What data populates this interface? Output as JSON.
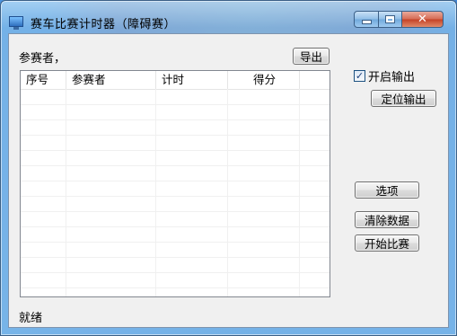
{
  "window": {
    "title": "赛车比赛计时器（障碍赛）"
  },
  "left_panel": {
    "participants_label": "参赛者，",
    "export_button": "导出"
  },
  "table": {
    "columns": [
      "序号",
      "参赛者",
      "计时",
      "得分"
    ],
    "rows": []
  },
  "right_panel": {
    "output_checkbox_label": "开启输出",
    "output_checked": true,
    "locate_output_button": "定位输出",
    "options_button": "选项",
    "clear_data_button": "清除数据",
    "start_race_button": "开始比赛"
  },
  "status_bar": {
    "text": "就绪"
  },
  "icons": {
    "app": "app-window-icon",
    "minimize": "minimize-icon",
    "maximize": "maximize-icon",
    "close": "close-icon",
    "check": "checkmark-icon"
  }
}
